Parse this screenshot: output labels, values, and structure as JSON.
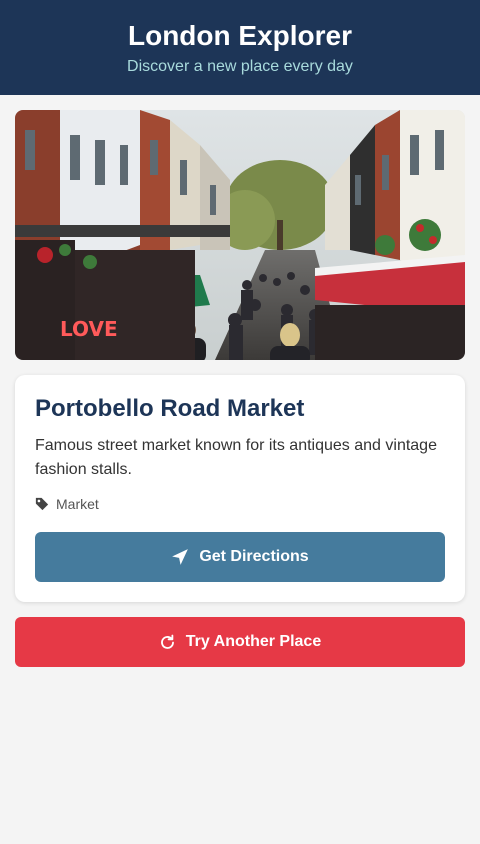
{
  "app": {
    "title": "London Explorer",
    "subtitle": "Discover a new place every day"
  },
  "place": {
    "name": "Portobello Road Market",
    "description": "Famous street market known for its antiques and vintage fashion stalls.",
    "category": "Market",
    "category_icon": "tag-icon",
    "photo_sign_text": "LOVE"
  },
  "actions": {
    "directions_label": "Get Directions",
    "directions_icon": "location-arrow-icon",
    "try_another_label": "Try Another Place",
    "try_another_icon": "redo-icon"
  },
  "colors": {
    "header_bg": "#1d3557",
    "subtitle": "#a8dadc",
    "directions_button": "#457b9d",
    "try_another_button": "#e63946"
  }
}
